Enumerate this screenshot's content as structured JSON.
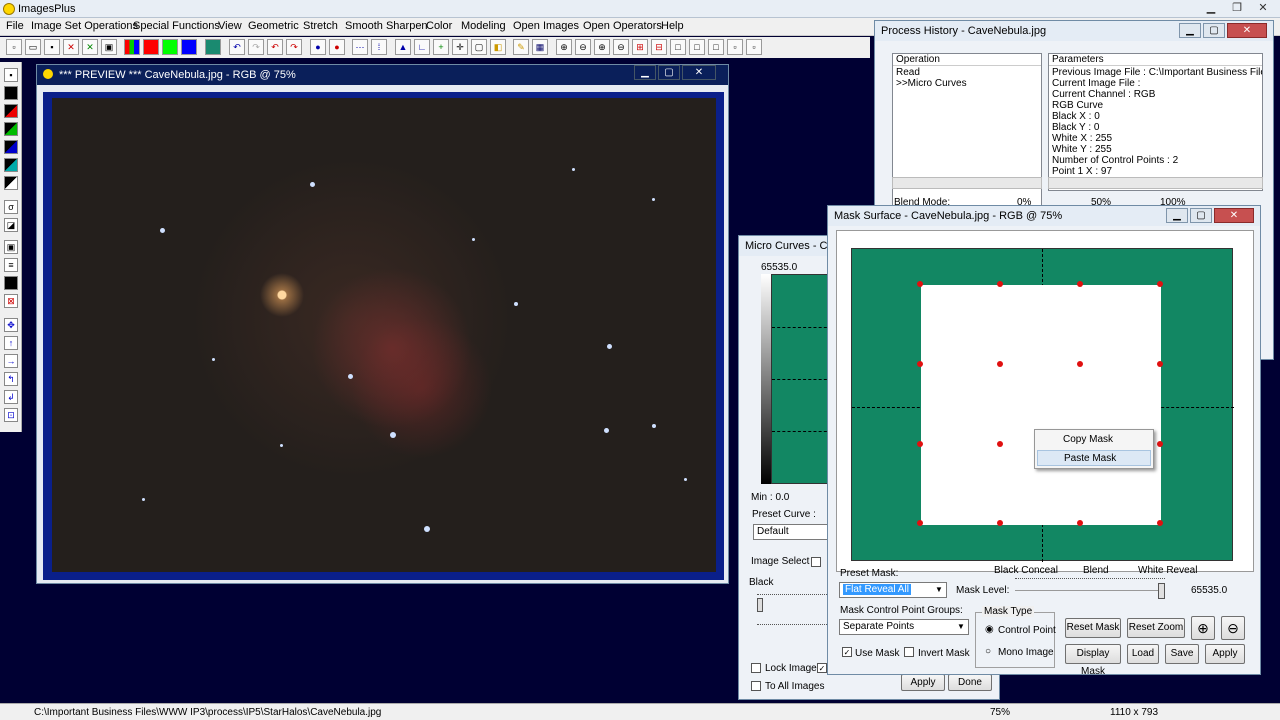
{
  "app": {
    "title": "ImagesPlus",
    "menu": [
      "File",
      "Image Set Operations",
      "Special Functions",
      "View",
      "Geometric",
      "Stretch",
      "Smooth Sharpen",
      "Color",
      "Modeling",
      "Open Images",
      "Open Operators",
      "Help"
    ]
  },
  "preview": {
    "title": "*** PREVIEW *** CaveNebula.jpg - RGB @ 75%"
  },
  "process_history": {
    "title": "Process History - CaveNebula.jpg",
    "operation_header": "Operation",
    "parameters_header": "Parameters",
    "operations": [
      "Read",
      ">>Micro Curves"
    ],
    "parameters": [
      "Previous Image File : C:\\Important Business Files\\WWW",
      "Current Image File :",
      "Current Channel : RGB",
      "RGB Curve",
      " Black X : 0",
      " Black Y : 0",
      " White X : 255",
      " White Y : 255",
      " Number of Control Points : 2",
      " Point 1 X : 97"
    ],
    "blend_mode_label": "Blend Mode:",
    "blend_0": "0%",
    "blend_50": "50%",
    "blend_100": "100%"
  },
  "micro_curves": {
    "title": "Micro Curves - Cave",
    "max_label": "65535.0",
    "min_label": "Min :  0.0",
    "preset_curve_label": "Preset Curve :",
    "preset_curve_value": "Default",
    "image_select_label": "Image Select",
    "black_label": "Black",
    "lock_image_label": "Lock Image",
    "to_all_images_label": "To All Images",
    "apply_label": "Apply",
    "done_label": "Done"
  },
  "mask_surface": {
    "title": "Mask Surface - CaveNebula.jpg - RGB @ 75%",
    "context_menu": [
      "Copy Mask",
      "Paste Mask"
    ],
    "slider_labels": [
      "Black Conceal",
      "Blend",
      "White Reveal"
    ],
    "preset_mask_label": "Preset Mask:",
    "preset_mask_value": "Flat Reveal All",
    "mask_level_label": "Mask Level:",
    "mask_level_value": "65535.0",
    "control_point_groups_label": "Mask Control Point Groups:",
    "control_point_groups_value": "Separate Points",
    "mask_type_label": "Mask Type",
    "mask_type_options": [
      "Control Point",
      "Mono Image"
    ],
    "use_mask_label": "Use Mask",
    "invert_mask_label": "Invert Mask",
    "buttons": {
      "reset_mask": "Reset Mask",
      "reset_zoom": "Reset Zoom",
      "display_mask": "Display Mask",
      "load": "Load",
      "save": "Save",
      "apply": "Apply"
    }
  },
  "status": {
    "path": "C:\\Important Business Files\\WWW IP3\\process\\IP5\\StarHalos\\CaveNebula.jpg",
    "dimensions": "1110 x 793",
    "zoom": "75%"
  },
  "colors": {
    "desktop": "#000033",
    "mask_green": "#128763",
    "control_point": "#e01010",
    "preview_border": "#0a1f8a"
  }
}
